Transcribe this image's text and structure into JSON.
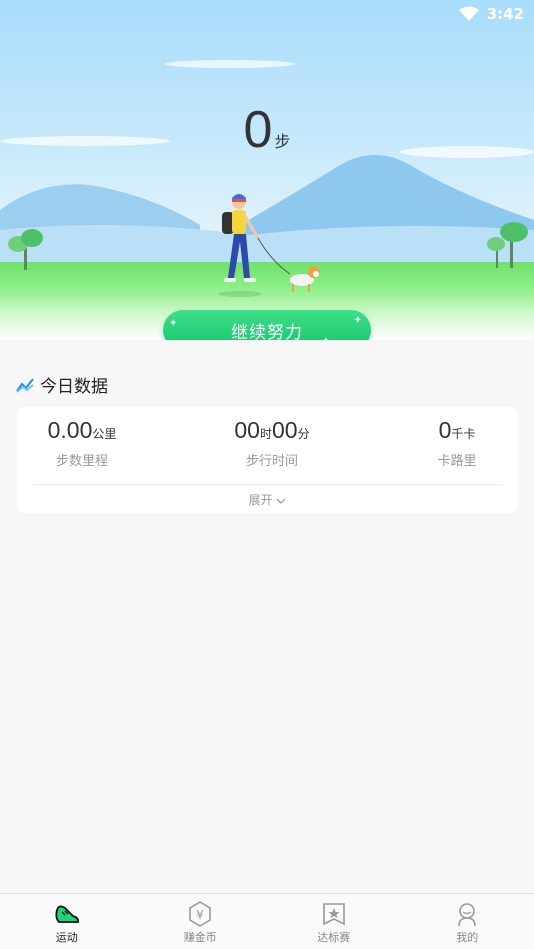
{
  "status_bar": {
    "time": "3:42",
    "wifi_icon": "wifi-icon"
  },
  "hero": {
    "step_count": "0",
    "step_unit": "步",
    "cta_label": "继续努力"
  },
  "today": {
    "title": "今日数据",
    "title_icon": "trend-chart-icon",
    "stats": [
      {
        "value": "0.00",
        "unit": "公里",
        "label": "步数里程"
      },
      {
        "value_h": "00",
        "unit_h": "时",
        "value_m": "00",
        "unit_m": "分",
        "label": "步行时间"
      },
      {
        "value": "0",
        "unit": "千卡",
        "label": "卡路里"
      }
    ],
    "expand_label": "展开"
  },
  "nav": {
    "items": [
      {
        "label": "运动",
        "icon": "sneaker-icon",
        "active": true
      },
      {
        "label": "赚金币",
        "icon": "coin-hexagon-icon",
        "active": false
      },
      {
        "label": "达标赛",
        "icon": "star-badge-icon",
        "active": false
      },
      {
        "label": "我的",
        "icon": "profile-icon",
        "active": false
      }
    ]
  },
  "colors": {
    "accent_green": "#16c46a",
    "sky_blue": "#a9dcfb",
    "text_primary": "#333333",
    "text_secondary": "#999999"
  }
}
